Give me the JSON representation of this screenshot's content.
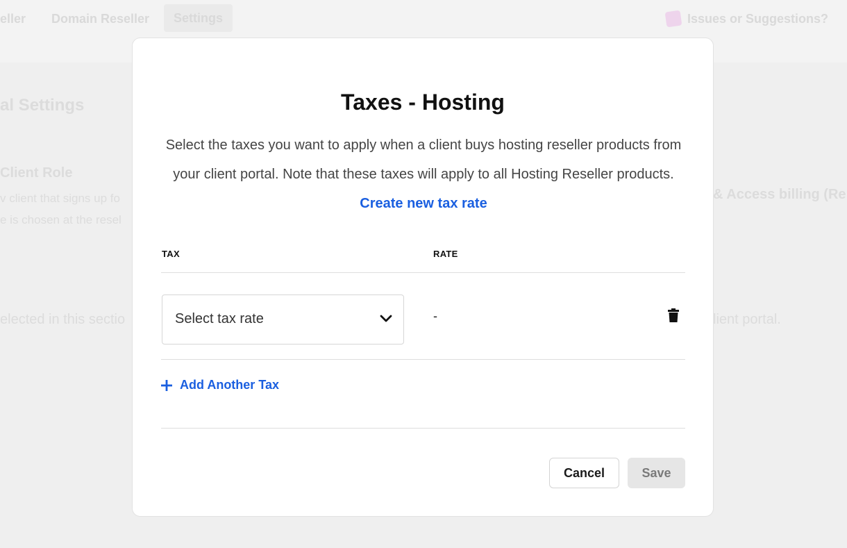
{
  "background": {
    "nav_tabs": [
      {
        "label": "eller"
      },
      {
        "label": "Domain Reseller"
      },
      {
        "label": "Settings"
      }
    ],
    "issues_link": "Issues or Suggestions?",
    "section_title": "al Settings",
    "client_role_heading": "Client Role",
    "client_role_line1": "v client that signs up fo",
    "client_role_line2": "e is chosen at the resel",
    "billing_heading": "& Access billing (Re",
    "selected_text_left": "elected in this sectio",
    "selected_text_right": "lient portal."
  },
  "modal": {
    "title": "Taxes - Hosting",
    "description": "Select the taxes you want to apply when a client buys hosting reseller products from your client portal. Note that these taxes will apply to all Hosting Reseller products.",
    "create_link": "Create new tax rate",
    "columns": {
      "tax": "TAX",
      "rate": "RATE"
    },
    "row": {
      "select_placeholder": "Select tax rate",
      "rate_value": "-"
    },
    "add_tax_label": "Add Another Tax",
    "cancel_label": "Cancel",
    "save_label": "Save"
  },
  "colors": {
    "link": "#1a5fe0",
    "save_disabled_bg": "#e6e6e6"
  },
  "icons": {
    "issues": "feedback-icon",
    "dropdown": "chevron-down-icon",
    "delete": "trash-icon",
    "add": "plus-icon"
  }
}
